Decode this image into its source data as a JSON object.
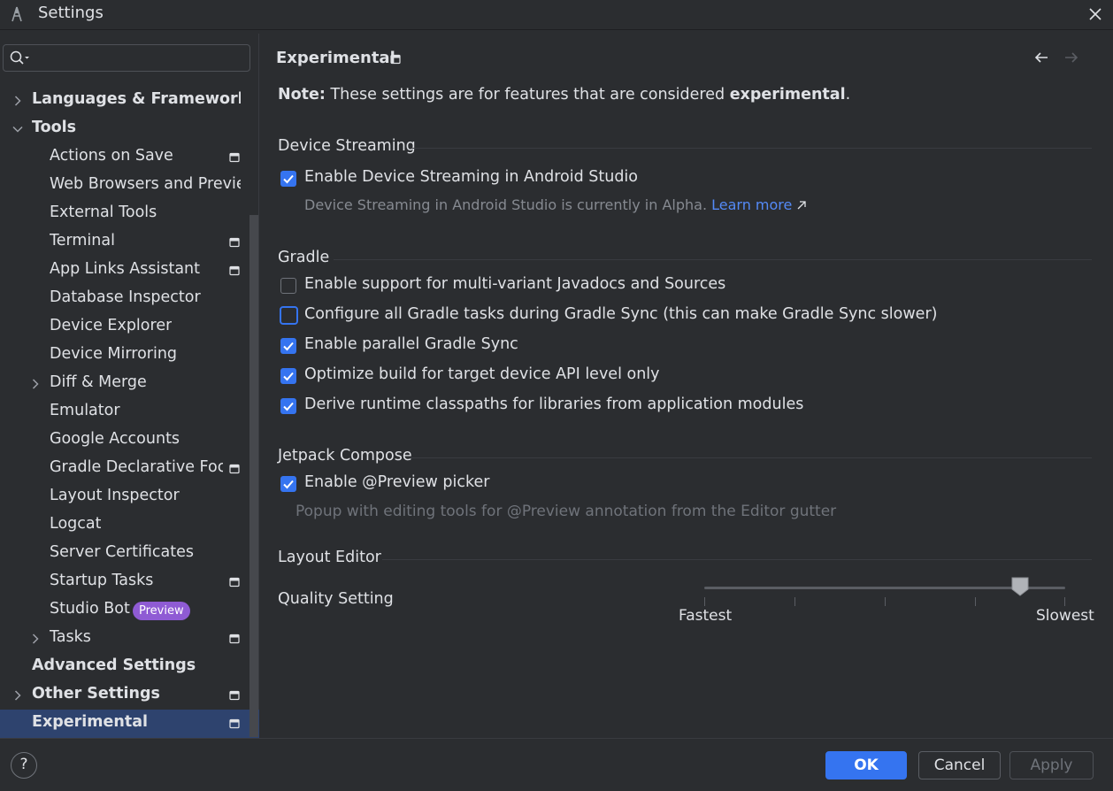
{
  "window": {
    "title": "Settings",
    "app_icon": "android-studio-icon",
    "close_icon": "close-icon"
  },
  "search": {
    "placeholder": "",
    "icon": "search-icon"
  },
  "sidebar": {
    "items": [
      {
        "label": "Languages & Frameworks",
        "bold": true,
        "chevron": "right"
      },
      {
        "label": "Tools",
        "bold": true,
        "chevron": "down"
      },
      {
        "label": "Actions on Save",
        "project": true
      },
      {
        "label": "Web Browsers and Preview"
      },
      {
        "label": "External Tools"
      },
      {
        "label": "Terminal",
        "project": true
      },
      {
        "label": "App Links Assistant",
        "project": true
      },
      {
        "label": "Database Inspector"
      },
      {
        "label": "Device Explorer"
      },
      {
        "label": "Device Mirroring"
      },
      {
        "label": "Diff & Merge",
        "chevron": "right"
      },
      {
        "label": "Emulator"
      },
      {
        "label": "Google Accounts"
      },
      {
        "label": "Gradle Declarative Focus",
        "project": true
      },
      {
        "label": "Layout Inspector"
      },
      {
        "label": "Logcat"
      },
      {
        "label": "Server Certificates"
      },
      {
        "label": "Startup Tasks",
        "project": true
      },
      {
        "label": "Studio Bot",
        "badge": "Preview"
      },
      {
        "label": "Tasks",
        "chevron": "right",
        "project": true
      },
      {
        "label": "Advanced Settings",
        "bold": true
      },
      {
        "label": "Other Settings",
        "bold": true,
        "chevron": "right",
        "project": true
      },
      {
        "label": "Experimental",
        "bold": true,
        "selected": true,
        "project": true
      }
    ]
  },
  "main": {
    "title": "Experimental",
    "note_prefix": "Note:",
    "note_text": "These settings are for features that are considered",
    "note_emph": "experimental",
    "note_suffix": ".",
    "sections": {
      "device_streaming": {
        "title": "Device Streaming",
        "enable_label": "Enable Device Streaming in Android Studio",
        "enable_checked": true,
        "hint": "Device Streaming in Android Studio is currently in Alpha.",
        "learn_more": "Learn more",
        "learn_more_icon": "external-link-icon"
      },
      "gradle": {
        "title": "Gradle",
        "options": [
          {
            "label": "Enable support for multi-variant Javadocs and Sources",
            "checked": false
          },
          {
            "label": "Configure all Gradle tasks during Gradle Sync (this can make Gradle Sync slower)",
            "checked": false,
            "focused": true
          },
          {
            "label": "Enable parallel Gradle Sync",
            "checked": true
          },
          {
            "label": "Optimize build for target device API level only",
            "checked": true
          },
          {
            "label": "Derive runtime classpaths for libraries from application modules",
            "checked": true
          }
        ]
      },
      "jetpack_compose": {
        "title": "Jetpack Compose",
        "enable_label": "Enable @Preview picker",
        "enable_checked": true,
        "hint": "Popup with editing tools for @Preview annotation from the Editor gutter"
      },
      "layout_editor": {
        "title": "Layout Editor",
        "quality_label": "Quality Setting",
        "slider_min_label": "Fastest",
        "slider_max_label": "Slowest",
        "slider_value_fraction": 0.875
      }
    }
  },
  "footer": {
    "help": "?",
    "ok": "OK",
    "cancel": "Cancel",
    "apply": "Apply",
    "apply_enabled": false
  },
  "colors": {
    "accent": "#3574f0",
    "selection": "#2e436e",
    "badge": "#8f5bd4",
    "link": "#548af7"
  }
}
